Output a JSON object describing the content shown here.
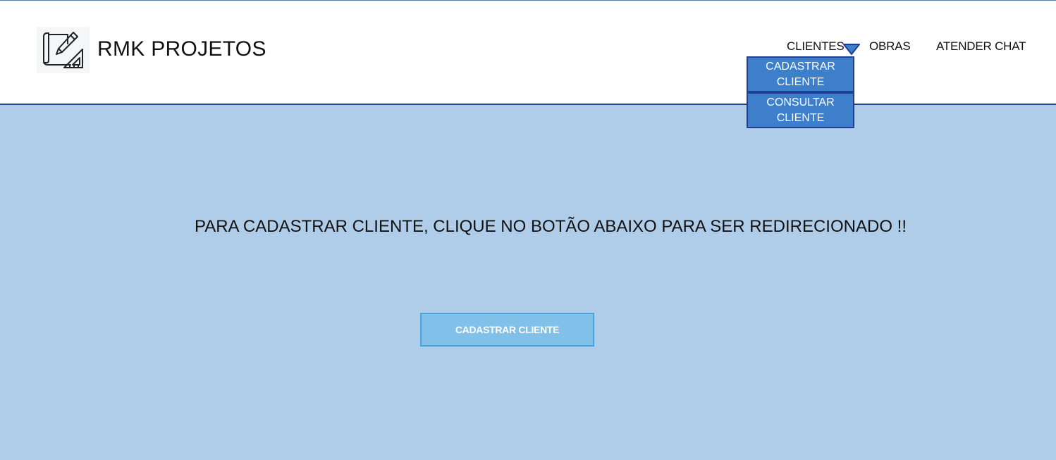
{
  "header": {
    "brand": "RMK PROJETOS",
    "logo_icon": "blueprint-pencil-ruler-icon",
    "nav": {
      "clientes": "CLIENTES",
      "obras": "OBRAS",
      "atender_chat": "ATENDER CHAT"
    },
    "dropdown_icon": "triangle-down-icon",
    "dropdown": {
      "cadastrar": "CADASTRAR CLIENTE",
      "consultar": "CONSULTAR CLIENTE"
    }
  },
  "main": {
    "message": "PARA CADASTRAR CLIENTE, CLIQUE NO BOTÃO ABAIXO PARA SER REDIRECIONADO !!",
    "button_label": "CADASTRAR CLIENTE"
  },
  "colors": {
    "page_background": "#afcde9",
    "header_background": "#ffffff",
    "header_border": "#26418f",
    "dropdown_background": "#3e7fcb",
    "dropdown_border": "#1e3f93",
    "button_background": "#80c0e9",
    "button_border": "#4aa4dc"
  }
}
